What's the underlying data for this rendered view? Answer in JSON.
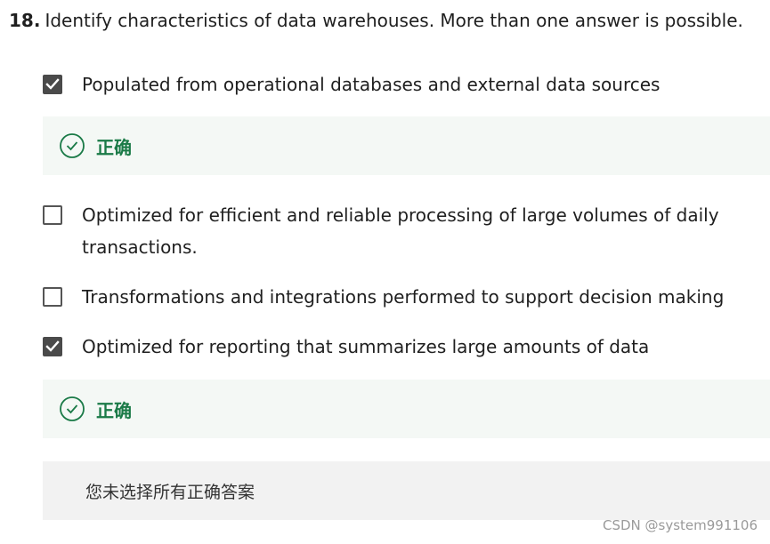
{
  "question": {
    "number": "18.",
    "text": "Identify characteristics of data warehouses. More than one answer is possible."
  },
  "options": [
    {
      "label": "Populated from operational databases and external data sources",
      "checked": true
    },
    {
      "label": "Optimized for efficient and reliable processing of large volumes of daily transactions.",
      "checked": false
    },
    {
      "label": "Transformations and integrations performed to support decision making",
      "checked": false
    },
    {
      "label": "Optimized for reporting that summarizes large amounts of data",
      "checked": true
    }
  ],
  "feedback": [
    {
      "label": "正确",
      "icon": "check-circle-icon"
    },
    {
      "label": "正确",
      "icon": "check-circle-icon"
    }
  ],
  "summary": {
    "text": "您未选择所有正确答案"
  },
  "watermark": {
    "text": "CSDN @system991106"
  },
  "colors": {
    "correct_green": "#1a7a47",
    "feedback_bg": "#f4f8f5",
    "summary_bg": "#f2f2f2",
    "checkbox_checked": "#4a4a4a"
  }
}
